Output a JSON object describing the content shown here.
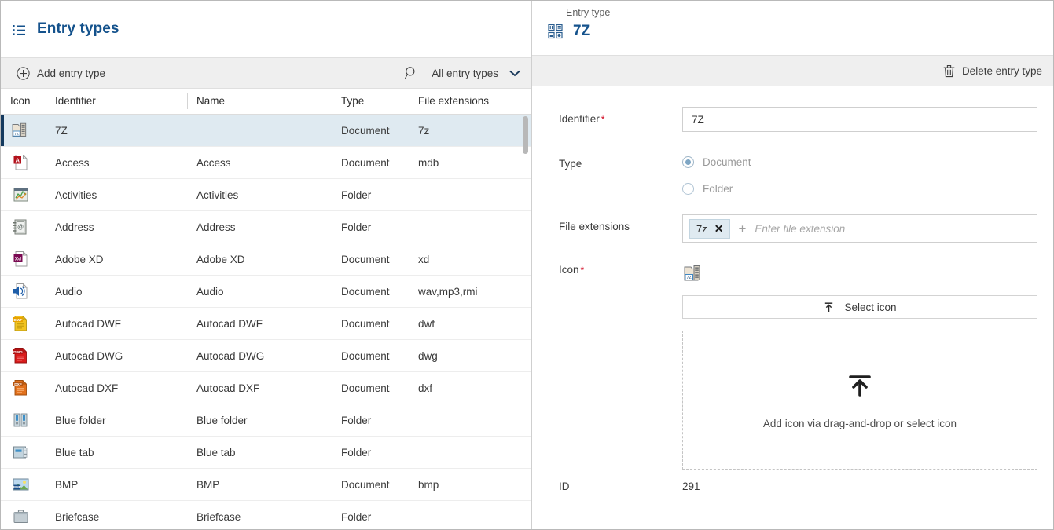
{
  "left": {
    "title": "Entry types",
    "title_icon": "list-icon",
    "toolbar": {
      "add_label": "Add entry type",
      "add_icon": "plus-circle-icon",
      "search_icon": "search-icon",
      "filter_value": "All entry types",
      "filter_chevron_icon": "chevron-down-icon"
    },
    "columns": [
      "Icon",
      "Identifier",
      "Name",
      "Type",
      "File extensions"
    ],
    "rows": [
      {
        "icon": "7z-archive-folder-icon",
        "identifier": "7Z",
        "name": "",
        "type": "Document",
        "extensions": "7z",
        "selected": true
      },
      {
        "icon": "access-document-icon",
        "identifier": "Access",
        "name": "Access",
        "type": "Document",
        "extensions": "mdb",
        "selected": false
      },
      {
        "icon": "activities-chart-icon",
        "identifier": "Activities",
        "name": "Activities",
        "type": "Folder",
        "extensions": "",
        "selected": false
      },
      {
        "icon": "address-book-icon",
        "identifier": "Address",
        "name": "Address",
        "type": "Folder",
        "extensions": "",
        "selected": false
      },
      {
        "icon": "adobe-xd-document-icon",
        "identifier": "Adobe XD",
        "name": "Adobe XD",
        "type": "Document",
        "extensions": "xd",
        "selected": false
      },
      {
        "icon": "audio-speaker-icon",
        "identifier": "Audio",
        "name": "Audio",
        "type": "Document",
        "extensions": "wav,mp3,rmi",
        "selected": false
      },
      {
        "icon": "autocad-dwf-icon",
        "identifier": "Autocad DWF",
        "name": "Autocad DWF",
        "type": "Document",
        "extensions": "dwf",
        "selected": false
      },
      {
        "icon": "autocad-dwg-icon",
        "identifier": "Autocad DWG",
        "name": "Autocad DWG",
        "type": "Document",
        "extensions": "dwg",
        "selected": false
      },
      {
        "icon": "autocad-dxf-icon",
        "identifier": "Autocad DXF",
        "name": "Autocad DXF",
        "type": "Document",
        "extensions": "dxf",
        "selected": false
      },
      {
        "icon": "blue-folder-binders-icon",
        "identifier": "Blue folder",
        "name": "Blue folder",
        "type": "Folder",
        "extensions": "",
        "selected": false
      },
      {
        "icon": "blue-tab-folder-icon",
        "identifier": "Blue tab",
        "name": "Blue tab",
        "type": "Folder",
        "extensions": "",
        "selected": false
      },
      {
        "icon": "bmp-image-icon",
        "identifier": "BMP",
        "name": "BMP",
        "type": "Document",
        "extensions": "bmp",
        "selected": false
      },
      {
        "icon": "briefcase-icon",
        "identifier": "Briefcase",
        "name": "Briefcase",
        "type": "Folder",
        "extensions": "",
        "selected": false
      }
    ]
  },
  "right": {
    "kicker": "Entry type",
    "title": "7Z",
    "title_icon": "entry-type-grid-icon",
    "toolbar": {
      "delete_label": "Delete entry type",
      "delete_icon": "trash-icon"
    },
    "form": {
      "identifier_label": "Identifier",
      "identifier_required": "*",
      "identifier_value": "7Z",
      "type_label": "Type",
      "type_options": [
        {
          "label": "Document",
          "checked": true
        },
        {
          "label": "Folder",
          "checked": false
        }
      ],
      "file_extensions_label": "File extensions",
      "file_extension_chips": [
        "7z"
      ],
      "file_extensions_placeholder": "Enter file extension",
      "icon_label": "Icon",
      "icon_required": "*",
      "icon_preview": "7z-archive-folder-icon",
      "select_icon_label": "Select icon",
      "select_icon_glyph": "upload-icon",
      "dropzone_text": "Add icon via drag-and-drop or select icon",
      "dropzone_glyph": "upload-icon",
      "id_label": "ID",
      "id_value": "291"
    }
  },
  "colors": {
    "accent": "#14528c",
    "selected_row_bg": "#dfeaf1",
    "selected_row_bar": "#13395e",
    "toolbar_bg": "#efefef",
    "required_star": "#d0021b"
  }
}
